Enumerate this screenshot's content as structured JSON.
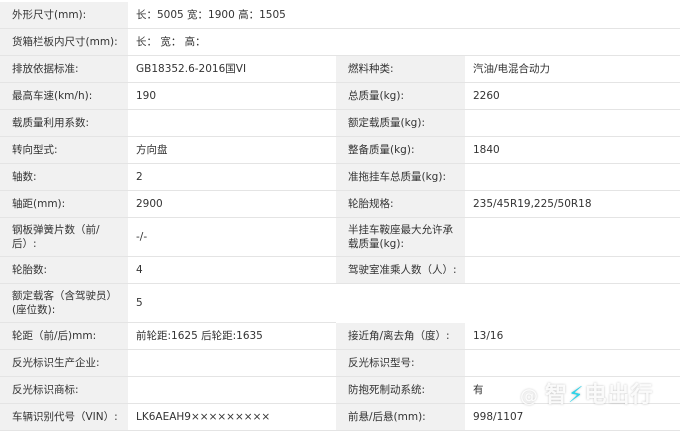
{
  "rows": [
    {
      "l1": "外形尺寸(mm):",
      "v1": "长：5005 宽：1900 高：1505"
    },
    {
      "l1": "货箱栏板内尺寸(mm):",
      "v1": "长：  宽：  高："
    },
    {
      "l1": "排放依据标准:",
      "v1": "GB18352.6-2016国VI",
      "l2": "燃料种类:",
      "v2": "汽油/电混合动力"
    },
    {
      "l1": "最高车速(km/h):",
      "v1": "190",
      "l2": "总质量(kg):",
      "v2": "2260"
    },
    {
      "l1": "载质量利用系数:",
      "v1": "",
      "l2": "额定载质量(kg):",
      "v2": ""
    },
    {
      "l1": "转向型式:",
      "v1": "方向盘",
      "l2": "整备质量(kg):",
      "v2": "1840"
    },
    {
      "l1": "轴数:",
      "v1": "2",
      "l2": "准拖挂车总质量(kg):",
      "v2": ""
    },
    {
      "l1": "轴距(mm):",
      "v1": "2900",
      "l2": "轮胎规格:",
      "v2": "235/45R19,225/50R18"
    },
    {
      "l1": "钢板弹簧片数（前/后）:",
      "v1": "-/-",
      "l2": "半挂车鞍座最大允许承载质量(kg):",
      "v2": ""
    },
    {
      "l1": "轮胎数:",
      "v1": "4",
      "l2": "驾驶室准乘人数（人）:",
      "v2": ""
    },
    {
      "l1": "额定载客（含驾驶员）(座位数):",
      "v1": "5"
    },
    {
      "l1": "轮距（前/后)mm:",
      "v1": "前轮距:1625 后轮距:1635",
      "l2": "接近角/离去角（度）:",
      "v2": "13/16"
    },
    {
      "l1": "反光标识生产企业:",
      "v1": "",
      "l2": "反光标识型号:",
      "v2": ""
    },
    {
      "l1": "反光标识商标:",
      "v1": "",
      "l2": "防抱死制动系统:",
      "v2": "有"
    },
    {
      "l1": "车辆识别代号（VIN）:",
      "v1": "LK6AEAH9×××××××××",
      "l2": "前悬/后悬(mm):",
      "v2": "998/1107"
    }
  ],
  "watermark": {
    "at": "@",
    "text1": "智",
    "text2": "电出行"
  }
}
